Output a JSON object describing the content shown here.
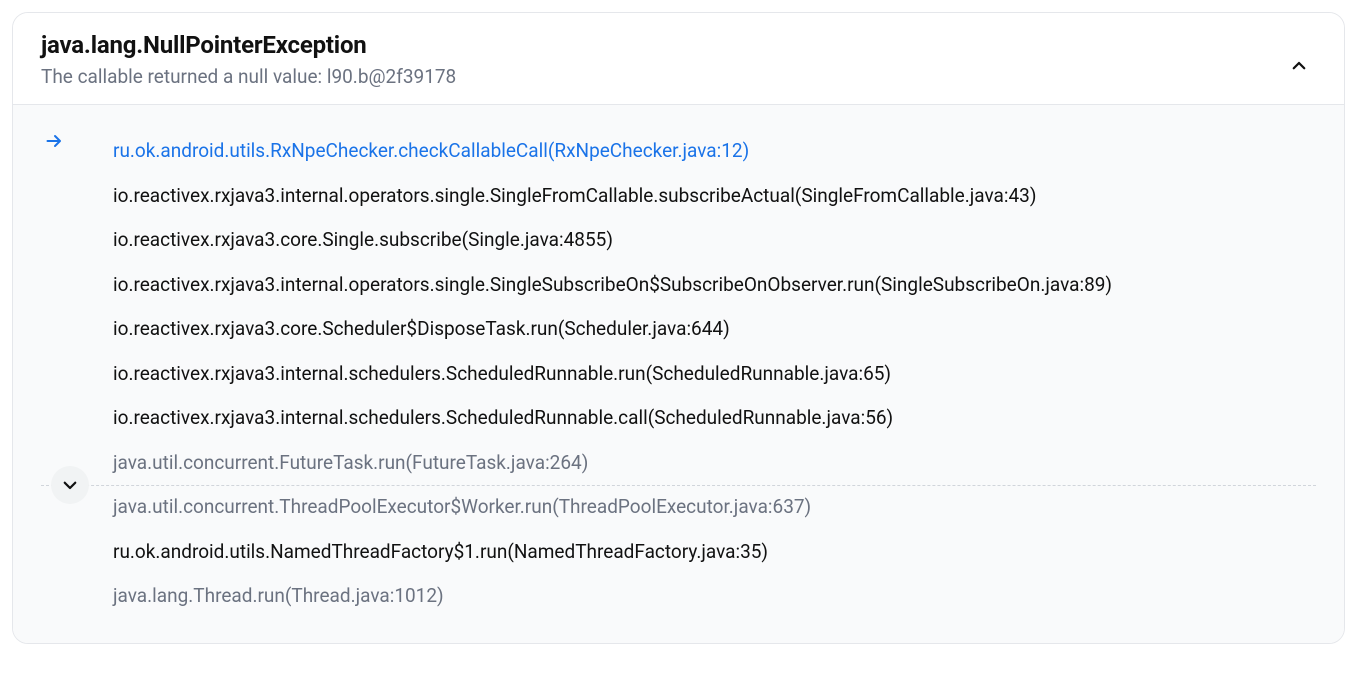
{
  "header": {
    "title": "java.lang.NullPointerException",
    "subtitle": "The callable returned a null value: l90.b@2f39178"
  },
  "frames": [
    {
      "text": "ru.ok.android.utils.RxNpeChecker.checkCallableCall(RxNpeChecker.java:12)",
      "style": "link",
      "icon": "arrow"
    },
    {
      "text": "io.reactivex.rxjava3.internal.operators.single.SingleFromCallable.subscribeActual(SingleFromCallable.java:43)",
      "style": "normal"
    },
    {
      "text": "io.reactivex.rxjava3.core.Single.subscribe(Single.java:4855)",
      "style": "normal"
    },
    {
      "text": "io.reactivex.rxjava3.internal.operators.single.SingleSubscribeOn$SubscribeOnObserver.run(SingleSubscribeOn.java:89)",
      "style": "normal"
    },
    {
      "text": "io.reactivex.rxjava3.core.Scheduler$DisposeTask.run(Scheduler.java:644)",
      "style": "normal"
    },
    {
      "text": "io.reactivex.rxjava3.internal.schedulers.ScheduledRunnable.run(ScheduledRunnable.java:65)",
      "style": "normal"
    },
    {
      "text": "io.reactivex.rxjava3.internal.schedulers.ScheduledRunnable.call(ScheduledRunnable.java:56)",
      "style": "normal"
    },
    {
      "text": "java.util.concurrent.FutureTask.run(FutureTask.java:264)",
      "style": "muted",
      "divider_after": true
    },
    {
      "text": "java.util.concurrent.ThreadPoolExecutor$Worker.run(ThreadPoolExecutor.java:637)",
      "style": "muted"
    },
    {
      "text": "ru.ok.android.utils.NamedThreadFactory$1.run(NamedThreadFactory.java:35)",
      "style": "normal"
    },
    {
      "text": "java.lang.Thread.run(Thread.java:1012)",
      "style": "muted"
    }
  ]
}
